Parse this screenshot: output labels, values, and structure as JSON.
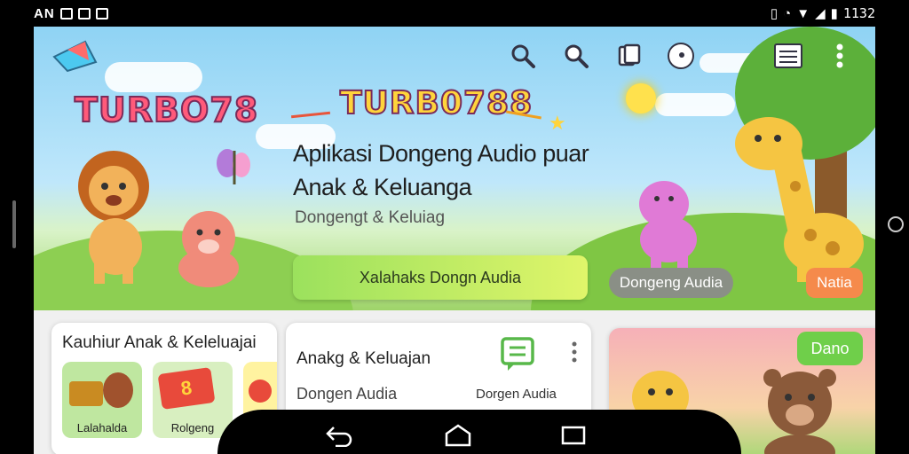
{
  "status_bar": {
    "carrier": "AN",
    "left_icons": [
      "app-icon",
      "notification-icon",
      "cast-icon"
    ],
    "right_icons": [
      "vibrate-icon",
      "alarm-icon",
      "wifi-icon",
      "signal-icon",
      "battery-icon"
    ],
    "time": "1132"
  },
  "hero": {
    "logo_left": "TURBO78",
    "logo_center": "TURB0788",
    "title_line1": "Aplikasi Dongeng Audio puar",
    "title_line2": "Anak & Keluanga",
    "subtitle": "Dongengt & Keluiag",
    "cta_label": "Xalahaks Dongn Audia",
    "pill_label": "Dongeng Audia",
    "orange_label": "Natia",
    "top_icons": [
      "search-icon",
      "search-icon",
      "bookmark-icon",
      "chat-icon",
      "menu-list-icon",
      "more-vert-icon"
    ]
  },
  "cards": {
    "card1": {
      "title": "Kauhiur Anak & Keleluajai",
      "tiles": [
        {
          "label": "Lalahalda"
        },
        {
          "label": "Rolgeng"
        },
        {
          "label": ""
        }
      ]
    },
    "card2": {
      "title": "Anakg & Keluajan",
      "subtitle": "Dongen Audia",
      "icon_label": "Dorgen Audia"
    },
    "card3": {
      "badge": "Dano"
    }
  },
  "nav": {
    "back": "back-icon",
    "home": "home-icon",
    "recents": "recents-icon"
  }
}
